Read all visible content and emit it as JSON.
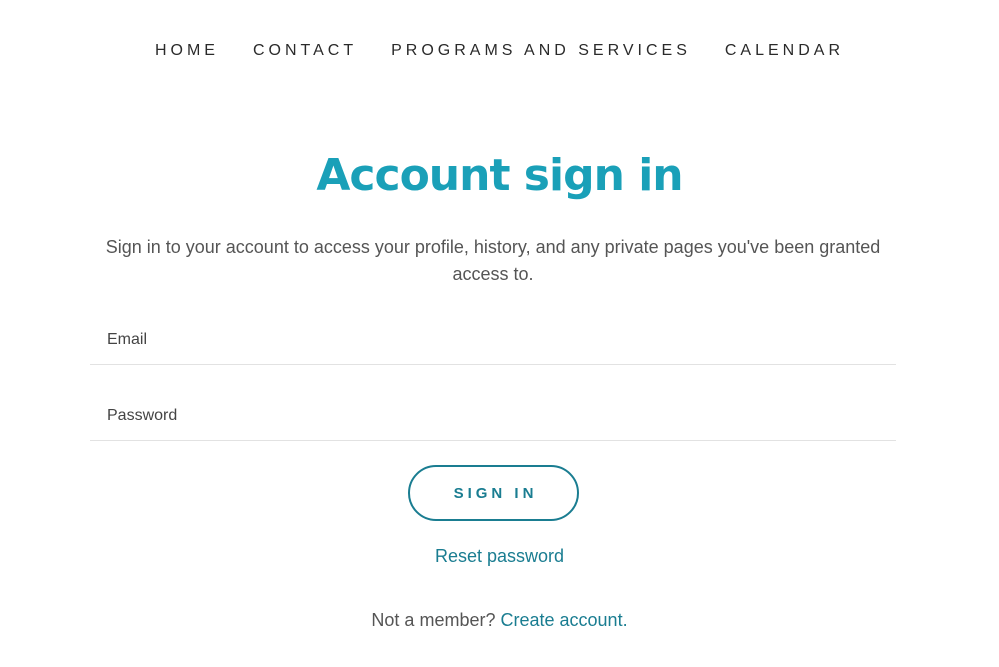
{
  "nav": {
    "items": [
      {
        "label": "HOME"
      },
      {
        "label": "CONTACT"
      },
      {
        "label": "PROGRAMS AND SERVICES"
      },
      {
        "label": "CALENDAR"
      }
    ]
  },
  "main": {
    "title": "Account sign in",
    "intro": "Sign in to your account to access your profile, history, and any private pages you've been granted access to.",
    "form": {
      "email_placeholder": "Email",
      "email_value": "",
      "password_placeholder": "Password",
      "password_value": "",
      "submit_label": "SIGN IN"
    },
    "reset_label": "Reset password",
    "member_prompt": "Not a member?",
    "create_account_label": "Create account."
  },
  "colors": {
    "accent": "#1aa0b8",
    "link": "#1a7d91",
    "text": "#555555",
    "divider": "#e2e2e2"
  }
}
